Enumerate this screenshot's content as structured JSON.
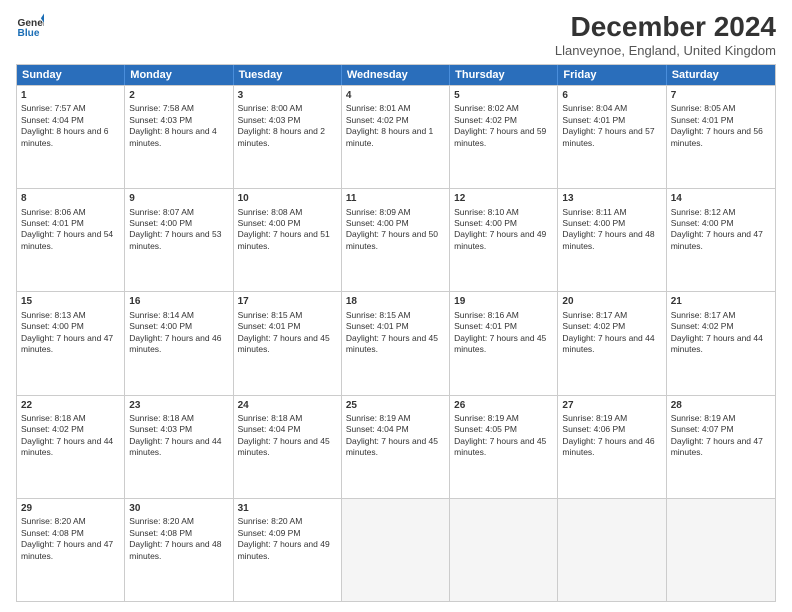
{
  "logo": {
    "line1": "General",
    "line2": "Blue"
  },
  "title": "December 2024",
  "subtitle": "Llanveynoe, England, United Kingdom",
  "weekdays": [
    "Sunday",
    "Monday",
    "Tuesday",
    "Wednesday",
    "Thursday",
    "Friday",
    "Saturday"
  ],
  "weeks": [
    [
      {
        "day": "1",
        "rise": "Sunrise: 7:57 AM",
        "set": "Sunset: 4:04 PM",
        "light": "Daylight: 8 hours and 6 minutes."
      },
      {
        "day": "2",
        "rise": "Sunrise: 7:58 AM",
        "set": "Sunset: 4:03 PM",
        "light": "Daylight: 8 hours and 4 minutes."
      },
      {
        "day": "3",
        "rise": "Sunrise: 8:00 AM",
        "set": "Sunset: 4:03 PM",
        "light": "Daylight: 8 hours and 2 minutes."
      },
      {
        "day": "4",
        "rise": "Sunrise: 8:01 AM",
        "set": "Sunset: 4:02 PM",
        "light": "Daylight: 8 hours and 1 minute."
      },
      {
        "day": "5",
        "rise": "Sunrise: 8:02 AM",
        "set": "Sunset: 4:02 PM",
        "light": "Daylight: 7 hours and 59 minutes."
      },
      {
        "day": "6",
        "rise": "Sunrise: 8:04 AM",
        "set": "Sunset: 4:01 PM",
        "light": "Daylight: 7 hours and 57 minutes."
      },
      {
        "day": "7",
        "rise": "Sunrise: 8:05 AM",
        "set": "Sunset: 4:01 PM",
        "light": "Daylight: 7 hours and 56 minutes."
      }
    ],
    [
      {
        "day": "8",
        "rise": "Sunrise: 8:06 AM",
        "set": "Sunset: 4:01 PM",
        "light": "Daylight: 7 hours and 54 minutes."
      },
      {
        "day": "9",
        "rise": "Sunrise: 8:07 AM",
        "set": "Sunset: 4:00 PM",
        "light": "Daylight: 7 hours and 53 minutes."
      },
      {
        "day": "10",
        "rise": "Sunrise: 8:08 AM",
        "set": "Sunset: 4:00 PM",
        "light": "Daylight: 7 hours and 51 minutes."
      },
      {
        "day": "11",
        "rise": "Sunrise: 8:09 AM",
        "set": "Sunset: 4:00 PM",
        "light": "Daylight: 7 hours and 50 minutes."
      },
      {
        "day": "12",
        "rise": "Sunrise: 8:10 AM",
        "set": "Sunset: 4:00 PM",
        "light": "Daylight: 7 hours and 49 minutes."
      },
      {
        "day": "13",
        "rise": "Sunrise: 8:11 AM",
        "set": "Sunset: 4:00 PM",
        "light": "Daylight: 7 hours and 48 minutes."
      },
      {
        "day": "14",
        "rise": "Sunrise: 8:12 AM",
        "set": "Sunset: 4:00 PM",
        "light": "Daylight: 7 hours and 47 minutes."
      }
    ],
    [
      {
        "day": "15",
        "rise": "Sunrise: 8:13 AM",
        "set": "Sunset: 4:00 PM",
        "light": "Daylight: 7 hours and 47 minutes."
      },
      {
        "day": "16",
        "rise": "Sunrise: 8:14 AM",
        "set": "Sunset: 4:00 PM",
        "light": "Daylight: 7 hours and 46 minutes."
      },
      {
        "day": "17",
        "rise": "Sunrise: 8:15 AM",
        "set": "Sunset: 4:01 PM",
        "light": "Daylight: 7 hours and 45 minutes."
      },
      {
        "day": "18",
        "rise": "Sunrise: 8:15 AM",
        "set": "Sunset: 4:01 PM",
        "light": "Daylight: 7 hours and 45 minutes."
      },
      {
        "day": "19",
        "rise": "Sunrise: 8:16 AM",
        "set": "Sunset: 4:01 PM",
        "light": "Daylight: 7 hours and 45 minutes."
      },
      {
        "day": "20",
        "rise": "Sunrise: 8:17 AM",
        "set": "Sunset: 4:02 PM",
        "light": "Daylight: 7 hours and 44 minutes."
      },
      {
        "day": "21",
        "rise": "Sunrise: 8:17 AM",
        "set": "Sunset: 4:02 PM",
        "light": "Daylight: 7 hours and 44 minutes."
      }
    ],
    [
      {
        "day": "22",
        "rise": "Sunrise: 8:18 AM",
        "set": "Sunset: 4:02 PM",
        "light": "Daylight: 7 hours and 44 minutes."
      },
      {
        "day": "23",
        "rise": "Sunrise: 8:18 AM",
        "set": "Sunset: 4:03 PM",
        "light": "Daylight: 7 hours and 44 minutes."
      },
      {
        "day": "24",
        "rise": "Sunrise: 8:18 AM",
        "set": "Sunset: 4:04 PM",
        "light": "Daylight: 7 hours and 45 minutes."
      },
      {
        "day": "25",
        "rise": "Sunrise: 8:19 AM",
        "set": "Sunset: 4:04 PM",
        "light": "Daylight: 7 hours and 45 minutes."
      },
      {
        "day": "26",
        "rise": "Sunrise: 8:19 AM",
        "set": "Sunset: 4:05 PM",
        "light": "Daylight: 7 hours and 45 minutes."
      },
      {
        "day": "27",
        "rise": "Sunrise: 8:19 AM",
        "set": "Sunset: 4:06 PM",
        "light": "Daylight: 7 hours and 46 minutes."
      },
      {
        "day": "28",
        "rise": "Sunrise: 8:19 AM",
        "set": "Sunset: 4:07 PM",
        "light": "Daylight: 7 hours and 47 minutes."
      }
    ],
    [
      {
        "day": "29",
        "rise": "Sunrise: 8:20 AM",
        "set": "Sunset: 4:08 PM",
        "light": "Daylight: 7 hours and 47 minutes."
      },
      {
        "day": "30",
        "rise": "Sunrise: 8:20 AM",
        "set": "Sunset: 4:08 PM",
        "light": "Daylight: 7 hours and 48 minutes."
      },
      {
        "day": "31",
        "rise": "Sunrise: 8:20 AM",
        "set": "Sunset: 4:09 PM",
        "light": "Daylight: 7 hours and 49 minutes."
      },
      null,
      null,
      null,
      null
    ]
  ]
}
